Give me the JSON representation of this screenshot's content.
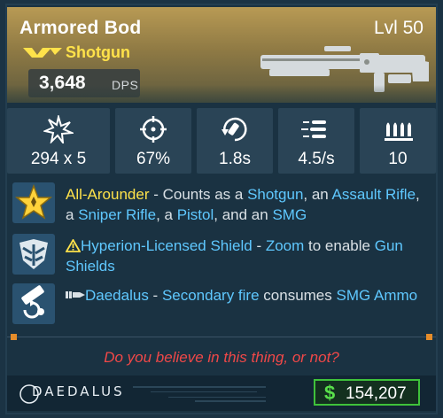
{
  "item": {
    "name": "Armored Bod",
    "level": "Lvl 50",
    "weapon_type": "Shotgun",
    "dps_value": "3,648",
    "dps_label": "DPS",
    "rarity_color": "#ffe24a"
  },
  "stats": [
    {
      "icon": "damage-burst-icon",
      "value": "294 x 5"
    },
    {
      "icon": "accuracy-crosshair-icon",
      "value": "67%"
    },
    {
      "icon": "reload-icon",
      "value": "1.8s"
    },
    {
      "icon": "fire-rate-icon",
      "value": "4.5/s"
    },
    {
      "icon": "magazine-icon",
      "value": "10"
    }
  ],
  "perks": [
    {
      "icon": "all-arounder-star-icon",
      "title": "All-Arounder",
      "text": {
        "p1": " - Counts as a ",
        "k1": "Shotgun",
        "p2": ", an ",
        "k2": "Assault Rifle",
        "p3": ", a ",
        "k3": "Sniper Rifle",
        "p4": ", a ",
        "k4": "Pistol",
        "p5": ", and an ",
        "k5": "SMG"
      }
    },
    {
      "icon": "hyperion-shield-icon",
      "title": "Hyperion-Licensed Shield",
      "text": {
        "p1": " - ",
        "k1": "Zoom",
        "p2": " to enable ",
        "k2": "Gun Shields"
      }
    },
    {
      "icon": "daedalus-secondary-fire-icon",
      "title": "Daedalus",
      "text": {
        "p1": " - ",
        "k1": "Secondary fire",
        "p2": " consumes ",
        "k2": "SMG Ammo"
      }
    }
  ],
  "flavor_text": "Do you believe in this thing, or not?",
  "manufacturer": "DAEDALUS",
  "price": {
    "currency_symbol": "$",
    "value": "154,207"
  },
  "colors": {
    "legendary_text": "#ffe24a",
    "keyword": "#5fc8ff",
    "flavor": "#f04848",
    "price_accent": "#3fc23b",
    "divider_accent": "#e58c2a"
  }
}
